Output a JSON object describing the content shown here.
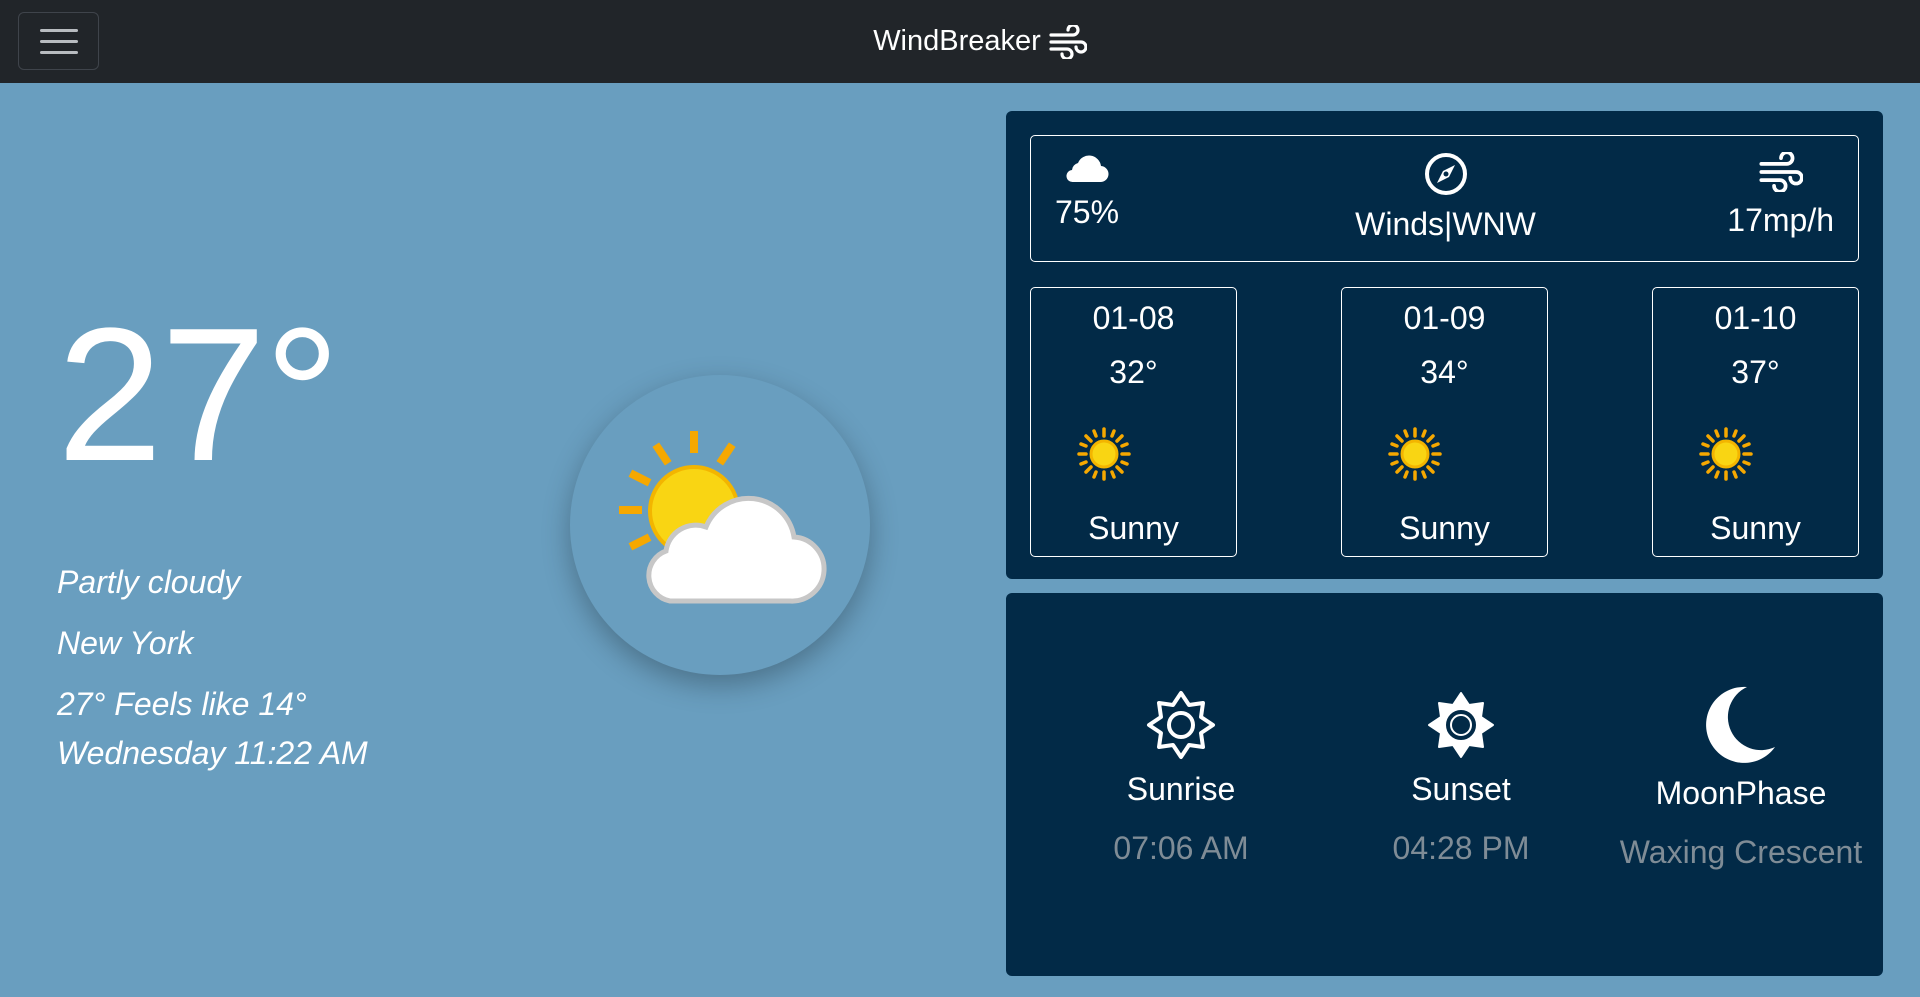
{
  "navbar": {
    "brand": "WindBreaker",
    "brand_icon": "wind-icon",
    "menu_icon": "hamburger-icon"
  },
  "current": {
    "temperature": "27°",
    "condition": "Partly cloudy",
    "city": "New York",
    "feels_like": "27° Feels like 14°",
    "datetime": "Wednesday 11:22 AM",
    "icon": "partly-cloudy-icon"
  },
  "stats": {
    "clouds": {
      "icon": "cloud-icon",
      "value": "75%"
    },
    "winds": {
      "icon": "compass-icon",
      "value": "Winds|WNW"
    },
    "speed": {
      "icon": "wind-icon",
      "value": "17mp/h"
    }
  },
  "forecast": [
    {
      "date": "01-08",
      "temp": "32°",
      "condition": "Sunny",
      "icon": "sun-icon"
    },
    {
      "date": "01-09",
      "temp": "34°",
      "condition": "Sunny",
      "icon": "sun-icon"
    },
    {
      "date": "01-10",
      "temp": "37°",
      "condition": "Sunny",
      "icon": "sun-icon"
    }
  ],
  "astro": {
    "sunrise": {
      "label": "Sunrise",
      "value": "07:06 AM",
      "icon": "sunrise-icon"
    },
    "sunset": {
      "label": "Sunset",
      "value": "04:28 PM",
      "icon": "sunset-icon"
    },
    "moon": {
      "label": "MoonPhase",
      "value": "Waxing Crescent",
      "icon": "moon-icon"
    }
  },
  "colors": {
    "background": "#699ebf",
    "navbar": "#212529",
    "panel": "#022a47",
    "muted_text": "#7f8c96"
  }
}
